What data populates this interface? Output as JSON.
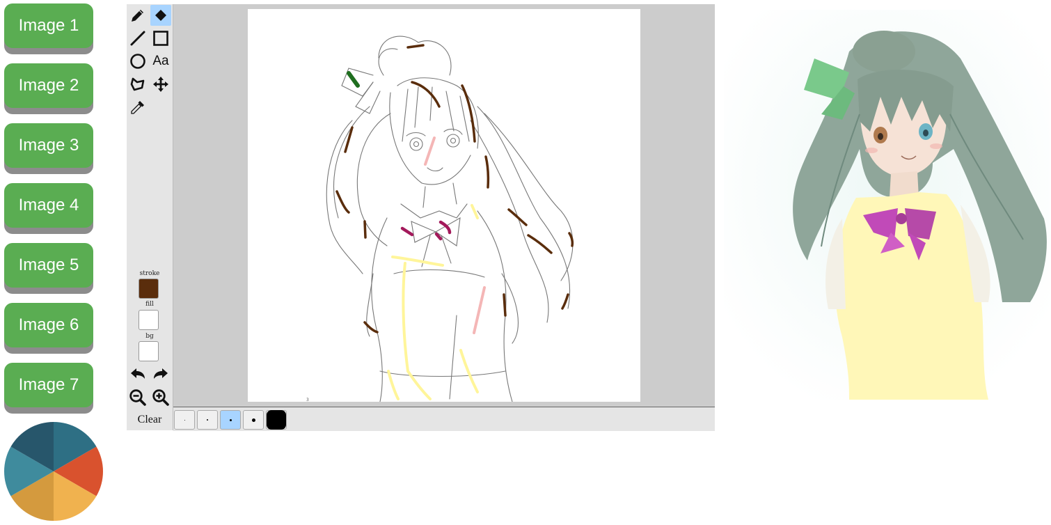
{
  "image_buttons": [
    "Image 1",
    "Image 2",
    "Image 3",
    "Image 4",
    "Image 5",
    "Image 6",
    "Image 7"
  ],
  "color_wheel": {
    "icon": "color-wheel-icon",
    "colors": [
      "#2e6f84",
      "#d9522e",
      "#f0b24f",
      "#d49a3e",
      "#3f8b9d",
      "#27566b"
    ]
  },
  "toolbar": {
    "tools": [
      {
        "name": "pencil",
        "icon": "pencil-icon",
        "active": false
      },
      {
        "name": "eraser",
        "icon": "eraser-icon",
        "active": true
      },
      {
        "name": "line",
        "icon": "line-icon",
        "active": false
      },
      {
        "name": "rectangle",
        "icon": "rectangle-icon",
        "active": false
      },
      {
        "name": "ellipse",
        "icon": "circle-icon",
        "active": false
      },
      {
        "name": "text",
        "icon": "text-icon",
        "label": "Aa",
        "active": false
      },
      {
        "name": "polygon",
        "icon": "polygon-icon",
        "active": false
      },
      {
        "name": "move",
        "icon": "move-icon",
        "active": false
      },
      {
        "name": "eyedropper",
        "icon": "eyedropper-icon",
        "active": false
      }
    ],
    "stroke_label": "stroke",
    "fill_label": "fill",
    "bg_label": "bg",
    "stroke_color": "#5a2d0c",
    "fill_color": "#ffffff",
    "bg_color": "#ffffff",
    "undo_icon": "undo-icon",
    "redo_icon": "redo-icon",
    "zoom_out_icon": "zoom-out-icon",
    "zoom_in_icon": "zoom-in-icon",
    "clear_label": "Clear"
  },
  "brush_sizes": [
    {
      "size": 1,
      "active": false
    },
    {
      "size": 2,
      "active": false
    },
    {
      "size": 3,
      "active": true
    },
    {
      "size": 5,
      "active": false
    },
    {
      "size": 28,
      "active": false
    }
  ],
  "canvas": {
    "sketch_label": "line-art sketch with color hint strokes",
    "hint_colors": [
      "#5a2d0c",
      "#1f6e1f",
      "#a3195b",
      "#f4b6b6",
      "#fff59a"
    ]
  },
  "output": {
    "label": "colorized anime girl result",
    "colors": [
      "#8fa69a",
      "#7ac98b",
      "#fff7b8",
      "#c14ab8",
      "#f6e2d6"
    ]
  }
}
